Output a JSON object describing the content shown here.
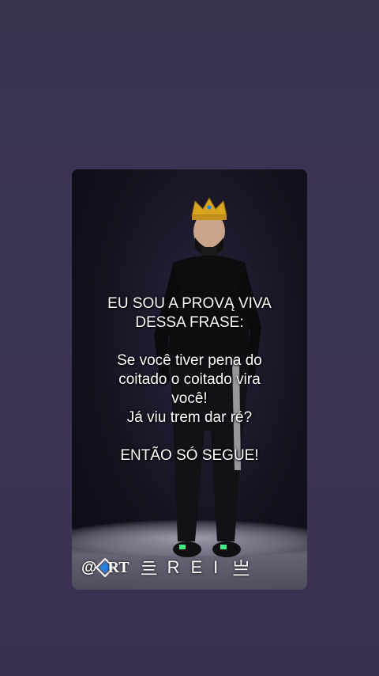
{
  "caption": {
    "lines": [
      "EU SOU A PROVĄ VIVA",
      "DESSA FRASE:",
      "",
      "Se você tiver pena do",
      "coitado o coitado vira",
      "você!",
      "Já viu trem dar ré?",
      "",
      "ENTÃO SÓ SEGUE!"
    ]
  },
  "footer": {
    "at": "@",
    "logo_text": "RT",
    "symbol_left": "亖",
    "name": "REI",
    "symbol_right": "亗"
  },
  "colors": {
    "background": "#3c3452",
    "text": "#ffffff",
    "crown": "#d9a520",
    "shoe_accent": "#3ef08a",
    "logo_blue": "#2a7fe0"
  },
  "icons": [
    "crown-icon",
    "diamond-logo-icon"
  ]
}
